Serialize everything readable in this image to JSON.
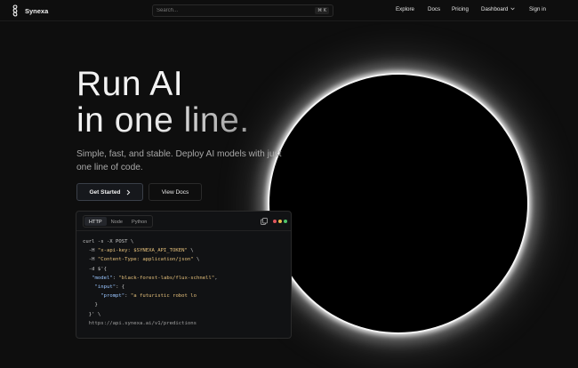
{
  "brand": {
    "name": "Synexa"
  },
  "search": {
    "placeholder": "Search...",
    "shortcut": "⌘ K"
  },
  "nav": {
    "explore": "Explore",
    "docs": "Docs",
    "pricing": "Pricing",
    "dashboard": "Dashboard",
    "signin": "Sign in"
  },
  "hero": {
    "title_line1": "Run AI",
    "title_line2": "in one line.",
    "subtitle": "Simple, fast, and stable. Deploy AI models with just one line of code.",
    "primary_cta": "Get Started",
    "secondary_cta": "View Docs"
  },
  "code": {
    "tabs": [
      "HTTP",
      "Node",
      "Python"
    ],
    "active_tab": "HTTP",
    "window_dot_colors": [
      "#e0555c",
      "#e8b84a",
      "#4fc46a"
    ],
    "lines": {
      "l1": "curl -s -X POST \\",
      "l2a": "  -H ",
      "l2b": "\"x-api-key: $SYNEXA_API_TOKEN\"",
      "l2c": " \\",
      "l3a": "  -H ",
      "l3b": "\"Content-Type: application/json\"",
      "l3c": " \\",
      "l4": "  -d $'{",
      "l5a": "   ",
      "l5b": "\"model\"",
      "l5c": ": ",
      "l5d": "\"black-forest-labs/flux-schnell\"",
      "l5e": ",",
      "l6a": "    ",
      "l6b": "\"input\"",
      "l6c": ": {",
      "l7a": "      ",
      "l7b": "\"prompt\"",
      "l7c": ": ",
      "l7d": "\"a futuristic robot lo",
      "l8": "    }",
      "l9": "  }' \\",
      "l10": "  https://api.synexa.ai/v1/predictions"
    }
  }
}
